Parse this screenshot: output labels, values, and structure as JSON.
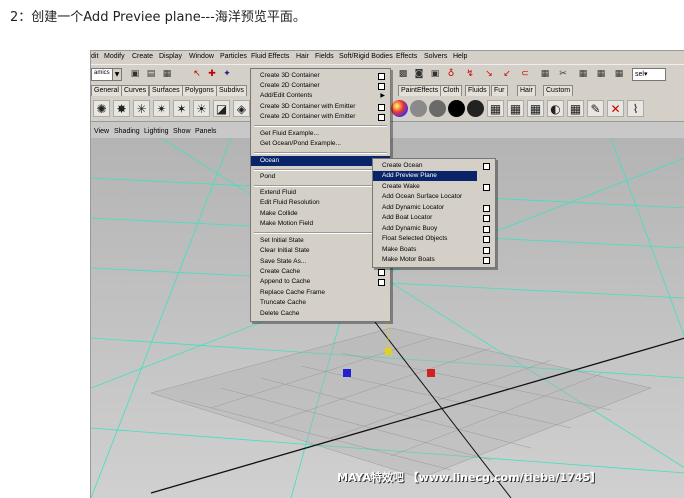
{
  "caption": "2：创建一个Add Previee plane---海洋预览平面。",
  "menubar": [
    "dit",
    "Modify",
    "Create",
    "Display",
    "Window",
    "Particles",
    "Fluid Effects",
    "Hair",
    "Fields",
    "Soft/Rigid Bodies",
    "Effects",
    "Solvers",
    "Help"
  ],
  "toolbar": {
    "mode_value": "amics",
    "dropdown_glyph": "▼",
    "sel_label": "sel▾"
  },
  "shelf_tabs": [
    "General",
    "Curves",
    "Surfaces",
    "Polygons",
    "Subdivs",
    "PaintEffects",
    "Cloth",
    "Fluids",
    "Fur",
    "Hair",
    "Custom"
  ],
  "panel_menu": [
    "View",
    "Shading",
    "Lighting",
    "Show",
    "Panels"
  ],
  "fluid_menu": {
    "items": [
      "Create 3D Container",
      "Create 2D Container",
      "Add/Edit Contents",
      "Create 3D Container with Emitter",
      "Create 2D Container with Emitter",
      "Get Fluid Example...",
      "Get Ocean/Pond Example...",
      "Ocean",
      "Pond",
      "Extend Fluid",
      "Edit Fluid Resolution",
      "Make Collide",
      "Make Motion Field",
      "Set Initial State",
      "Clear Initial State",
      "Save State As...",
      "Create Cache",
      "Append to Cache",
      "Replace Cache Frame",
      "Truncate Cache",
      "Delete Cache"
    ]
  },
  "ocean_menu": {
    "items": [
      "Create Ocean",
      "Add Preview Plane",
      "Create Wake",
      "Add Ocean Surface Locator",
      "Add Dynamic Locator",
      "Add Boat Locator",
      "Add Dynamic Buoy",
      "Float Selected Objects",
      "Make Boats",
      "Make Motor Boats"
    ]
  },
  "watermark": "MAYA特效吧 【www.linecg.com/tieba/1745】",
  "colors": {
    "menu_bg": "#d4d0c8",
    "highlight": "#0a246a",
    "viewport_bg": "#b9b9b9",
    "grid_cyan": "#40e0c0"
  }
}
